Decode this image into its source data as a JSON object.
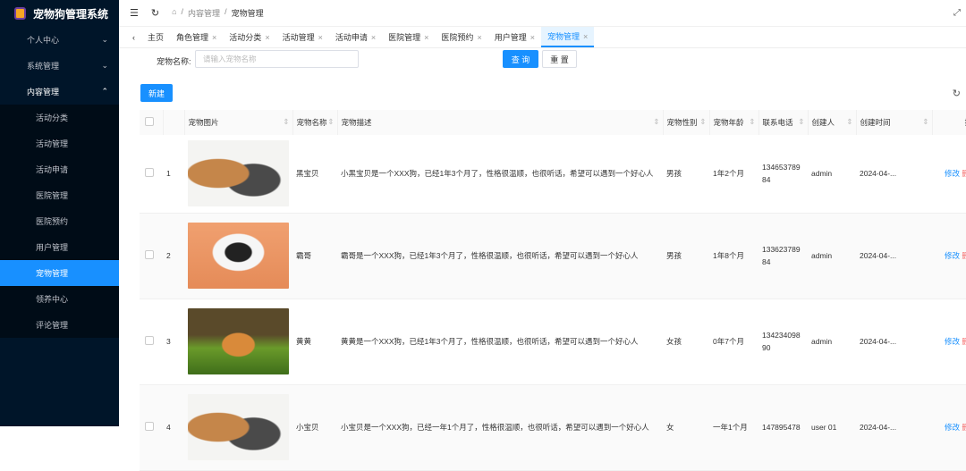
{
  "app": {
    "title": "宠物狗管理系统"
  },
  "sidebar": {
    "items": [
      {
        "label": "个人中心",
        "chev": "⌄"
      },
      {
        "label": "系统管理",
        "chev": "⌄"
      },
      {
        "label": "内容管理",
        "chev": "⌃"
      }
    ],
    "sub": [
      "活动分类",
      "活动管理",
      "活动申请",
      "医院管理",
      "医院预约",
      "用户管理",
      "宠物管理",
      "领养中心",
      "评论管理"
    ]
  },
  "breadcrumb": {
    "items": [
      "内容管理",
      "宠物管理"
    ],
    "sep": "/"
  },
  "tabs": [
    "主页",
    "角色管理",
    "活动分类",
    "活动管理",
    "活动申请",
    "医院管理",
    "医院预约",
    "用户管理",
    "宠物管理"
  ],
  "search": {
    "label": "宠物名称:",
    "placeholder": "请输入宠物名称",
    "query": "查 询",
    "reset": "重 置"
  },
  "toolbar": {
    "new": "新建"
  },
  "table": {
    "headers": [
      "宠物图片",
      "宠物名称",
      "宠物描述",
      "宠物性别",
      "宠物年龄",
      "联系电话",
      "创建人",
      "创建时间",
      "操作"
    ],
    "rows": [
      {
        "no": "1",
        "name": "黑宝贝",
        "desc": "小黑宝贝是一个XXX狗，已经1年3个月了，性格很温顺，也很听话，希望可以遇到一个好心人",
        "sex": "男孩",
        "age": "1年2个月",
        "phone": "13465378984",
        "creator": "admin",
        "time": "2024-04-...",
        "edit": "修改",
        "delete": "删除"
      },
      {
        "no": "2",
        "name": "霸哥",
        "desc": "霸哥是一个XXX狗，已经1年3个月了，性格很温顺，也很听话，希望可以遇到一个好心人",
        "sex": "男孩",
        "age": "1年8个月",
        "phone": "13362378984",
        "creator": "admin",
        "time": "2024-04-...",
        "edit": "修改",
        "delete": "删除"
      },
      {
        "no": "3",
        "name": "黄黄",
        "desc": "黄黄是一个XXX狗，已经1年3个月了，性格很温顺，也很听话，希望可以遇到一个好心人",
        "sex": "女孩",
        "age": "0年7个月",
        "phone": "13423409890",
        "creator": "admin",
        "time": "2024-04-...",
        "edit": "修改",
        "delete": "删除"
      },
      {
        "no": "4",
        "name": "小宝贝",
        "desc": "小宝贝是一个XXX狗，已经一年1个月了，性格很温顺，也很听话，希望可以遇到一个好心人",
        "sex": "女",
        "age": "一年1个月",
        "phone": "147895478",
        "creator": "user 01",
        "time": "2024-04-...",
        "edit": "修改",
        "delete": "删除"
      }
    ]
  }
}
